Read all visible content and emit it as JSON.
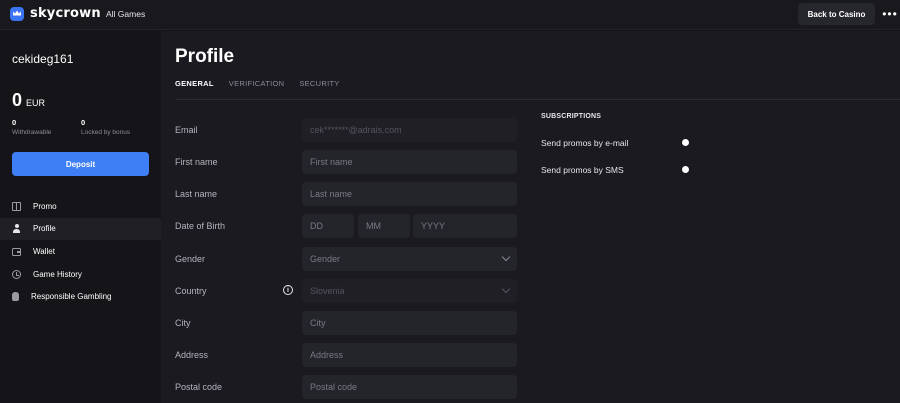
{
  "header": {
    "logo_text": "skycrown",
    "nav_link": "All Games",
    "back_button": "Back to Casino",
    "more_button": "•••"
  },
  "sidebar": {
    "username": "cekideg161",
    "balance": {
      "amount": "0",
      "currency": "EUR"
    },
    "withdrawable": {
      "value": "0",
      "label": "Withdrawable"
    },
    "locked": {
      "value": "0",
      "label": "Locked by bonus"
    },
    "deposit_button": "Deposit",
    "menu": [
      {
        "label": "Promo",
        "icon": "gift-icon"
      },
      {
        "label": "Profile",
        "icon": "user-icon",
        "active": true
      },
      {
        "label": "Wallet",
        "icon": "wallet-icon"
      },
      {
        "label": "Game History",
        "icon": "history-icon"
      },
      {
        "label": "Responsible Gambling",
        "icon": "hand-icon"
      }
    ]
  },
  "main": {
    "title": "Profile",
    "tabs": [
      {
        "label": "GENERAL",
        "active": true
      },
      {
        "label": "VERIFICATION"
      },
      {
        "label": "SECURITY"
      }
    ],
    "form": {
      "email": {
        "label": "Email",
        "value": "cek*******@adrais.com"
      },
      "first_name": {
        "label": "First name",
        "placeholder": "First name"
      },
      "last_name": {
        "label": "Last name",
        "placeholder": "Last name"
      },
      "dob": {
        "label": "Date of Birth",
        "dd": "DD",
        "mm": "MM",
        "yyyy": "YYYY"
      },
      "gender": {
        "label": "Gender",
        "value": "Gender"
      },
      "country": {
        "label": "Country",
        "value": "Slovenia"
      },
      "city": {
        "label": "City",
        "placeholder": "City"
      },
      "address": {
        "label": "Address",
        "placeholder": "Address"
      },
      "postal_code": {
        "label": "Postal code",
        "placeholder": "Postal code"
      }
    },
    "subscriptions": {
      "title": "SUBSCRIPTIONS",
      "email_label": "Send promos by e-mail",
      "sms_label": "Send promos by SMS"
    }
  },
  "colors": {
    "accent": "#3f7ff5",
    "background": "#141419",
    "panel": "#1a1a20",
    "field": "#24242b"
  }
}
